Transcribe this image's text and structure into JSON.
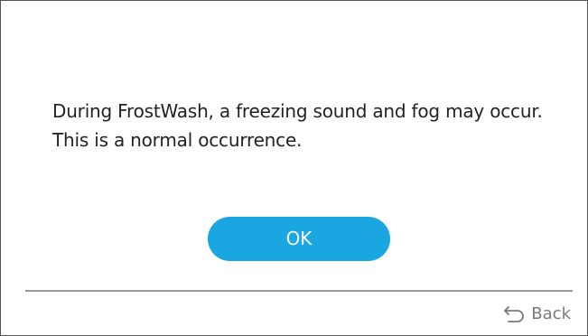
{
  "dialog": {
    "message": "During FrostWash, a freezing sound and fog may occur. This is a normal occurrence.",
    "ok_label": "OK"
  },
  "footer": {
    "back_label": "Back",
    "back_icon": "return-arrow-icon"
  },
  "colors": {
    "accent": "#1aa6e0",
    "text": "#222222",
    "muted": "#7a7a7a",
    "divider": "#9a9a9a"
  }
}
